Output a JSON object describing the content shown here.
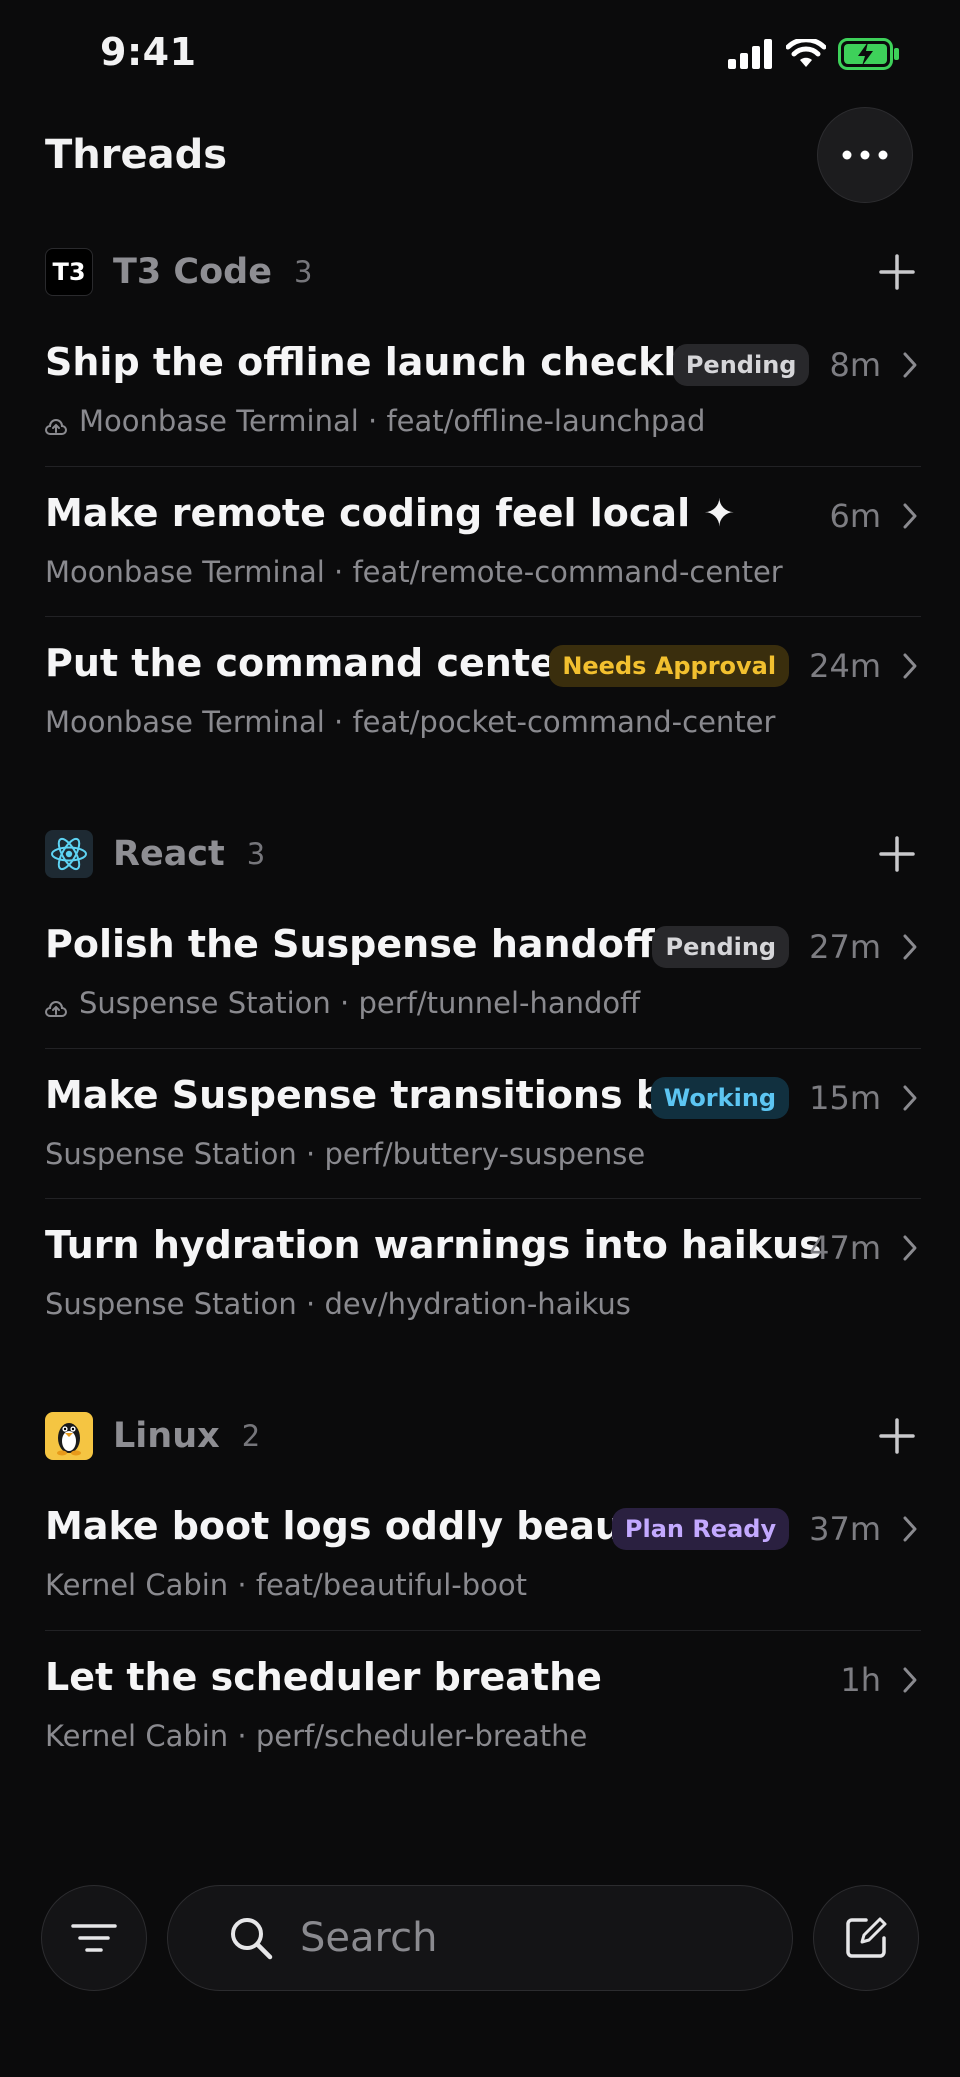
{
  "status_bar": {
    "time": "9:41"
  },
  "header": {
    "title": "Threads"
  },
  "groups": [
    {
      "name": "T3 Code",
      "count": "3",
      "icon": "t3-logo",
      "icon_label": "T3",
      "threads": [
        {
          "title": "Ship the offline launch checkli…",
          "subtitle": "Moonbase Terminal · feat/offline-launchpad",
          "cloud": true,
          "badge": "Pending",
          "badge_style": "pending",
          "time": "8m"
        },
        {
          "title": "Make remote coding feel local ✦",
          "subtitle": "Moonbase Terminal · feat/remote-command-center",
          "cloud": false,
          "badge": "",
          "badge_style": "",
          "time": "6m"
        },
        {
          "title": "Put the command cente…",
          "subtitle": "Moonbase Terminal · feat/pocket-command-center",
          "cloud": false,
          "badge": "Needs Approval",
          "badge_style": "approval",
          "time": "24m"
        }
      ]
    },
    {
      "name": "React",
      "count": "3",
      "icon": "react-logo",
      "icon_label": "",
      "threads": [
        {
          "title": "Polish the Suspense handoff…",
          "subtitle": "Suspense Station · perf/tunnel-handoff",
          "cloud": true,
          "badge": "Pending",
          "badge_style": "pending",
          "time": "27m"
        },
        {
          "title": "Make Suspense transitions b…",
          "subtitle": "Suspense Station · perf/buttery-suspense",
          "cloud": false,
          "badge": "Working",
          "badge_style": "working",
          "time": "15m"
        },
        {
          "title": "Turn hydration warnings into haikus",
          "subtitle": "Suspense Station · dev/hydration-haikus",
          "cloud": false,
          "badge": "",
          "badge_style": "",
          "time": "47m"
        }
      ]
    },
    {
      "name": "Linux",
      "count": "2",
      "icon": "linux-penguin",
      "icon_label": "",
      "threads": [
        {
          "title": "Make boot logs oddly beau…",
          "subtitle": "Kernel Cabin · feat/beautiful-boot",
          "cloud": false,
          "badge": "Plan Ready",
          "badge_style": "plan",
          "time": "37m"
        },
        {
          "title": "Let the scheduler breathe",
          "subtitle": "Kernel Cabin · perf/scheduler-breathe",
          "cloud": false,
          "badge": "",
          "badge_style": "",
          "time": "1h"
        }
      ]
    }
  ],
  "search": {
    "placeholder": "Search"
  },
  "colors": {
    "background": "#0b0b0c",
    "battery": "#3ed15a",
    "react": "#5ed3f3",
    "linux": "#f5c542"
  }
}
